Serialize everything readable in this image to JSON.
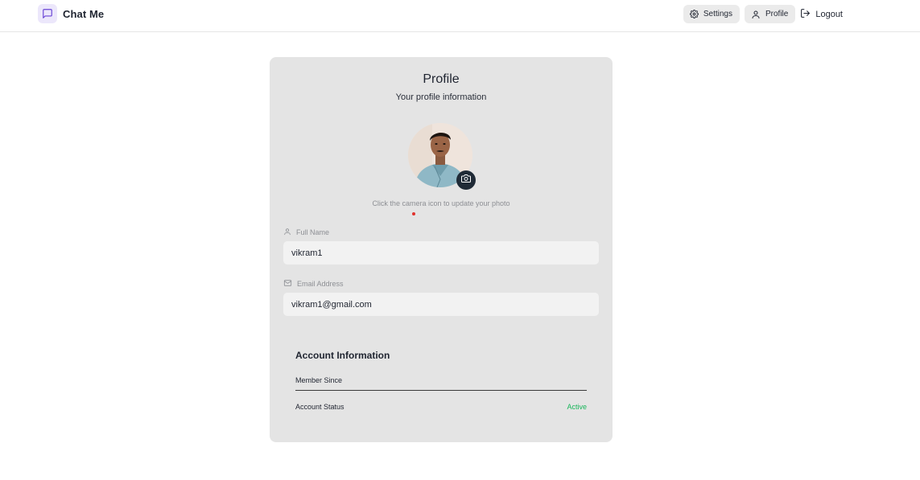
{
  "header": {
    "app_name": "Chat Me",
    "settings_label": "Settings",
    "profile_label": "Profile",
    "logout_label": "Logout"
  },
  "profile": {
    "title": "Profile",
    "subtitle": "Your profile information",
    "avatar_hint": "Click the camera icon to update your photo",
    "full_name_label": "Full Name",
    "full_name_value": "vikram1",
    "email_label": "Email Address",
    "email_value": "vikram1@gmail.com"
  },
  "account": {
    "title": "Account Information",
    "member_since_label": "Member Since",
    "member_since_value": "",
    "status_label": "Account Status",
    "status_value": "Active"
  },
  "colors": {
    "accent": "#ece7fb",
    "status_active": "#18b65a",
    "card_bg": "#e4e4e4"
  }
}
